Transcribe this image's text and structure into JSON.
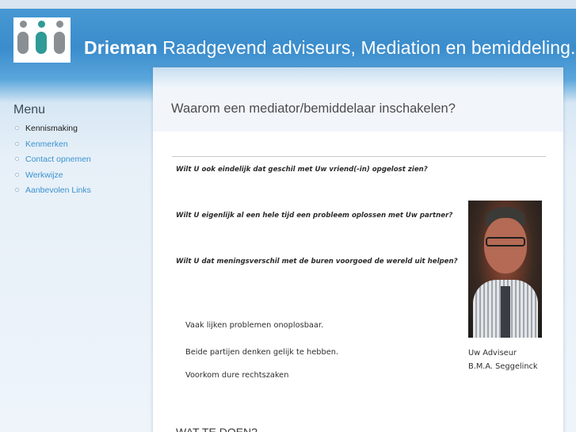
{
  "header": {
    "brand_bold": "Drieman",
    "brand_rest": " Raadgevend adviseurs, Mediation en bemiddeling."
  },
  "logo": {
    "colors": [
      "#8a8f93",
      "#2f9a96",
      "#8a8f93"
    ],
    "icon": "three-people-logo-icon"
  },
  "sidebar": {
    "title": "Menu",
    "items": [
      {
        "label": "Kennismaking",
        "active": true
      },
      {
        "label": "Kenmerken",
        "active": false
      },
      {
        "label": "Contact opnemen",
        "active": false
      },
      {
        "label": "Werkwijze",
        "active": false
      },
      {
        "label": "Aanbevolen Links",
        "active": false
      }
    ]
  },
  "main": {
    "title": "Waarom een mediator/bemiddelaar inschakelen?",
    "questions": [
      "Wilt U ook eindelijk dat geschil met Uw vriend(-in) opgelost zien?",
      "Wilt U eigenlijk al een hele tijd een probleem oplossen met Uw partner?",
      "Wilt U dat meningsverschil met de buren voorgoed de wereld uit helpen?"
    ],
    "paragraphs": [
      "Vaak lijken problemen onoplosbaar.",
      "Beide partijen denken gelijk te hebben.",
      "Voorkom dure rechtszaken"
    ],
    "photo_caption": [
      "Uw Adviseur",
      "B.M.A. Seggelinck"
    ],
    "next_heading": "WAT TE DOEN?"
  },
  "colors": {
    "link": "#3a92cf",
    "header_blue": "#3a8ccc"
  }
}
